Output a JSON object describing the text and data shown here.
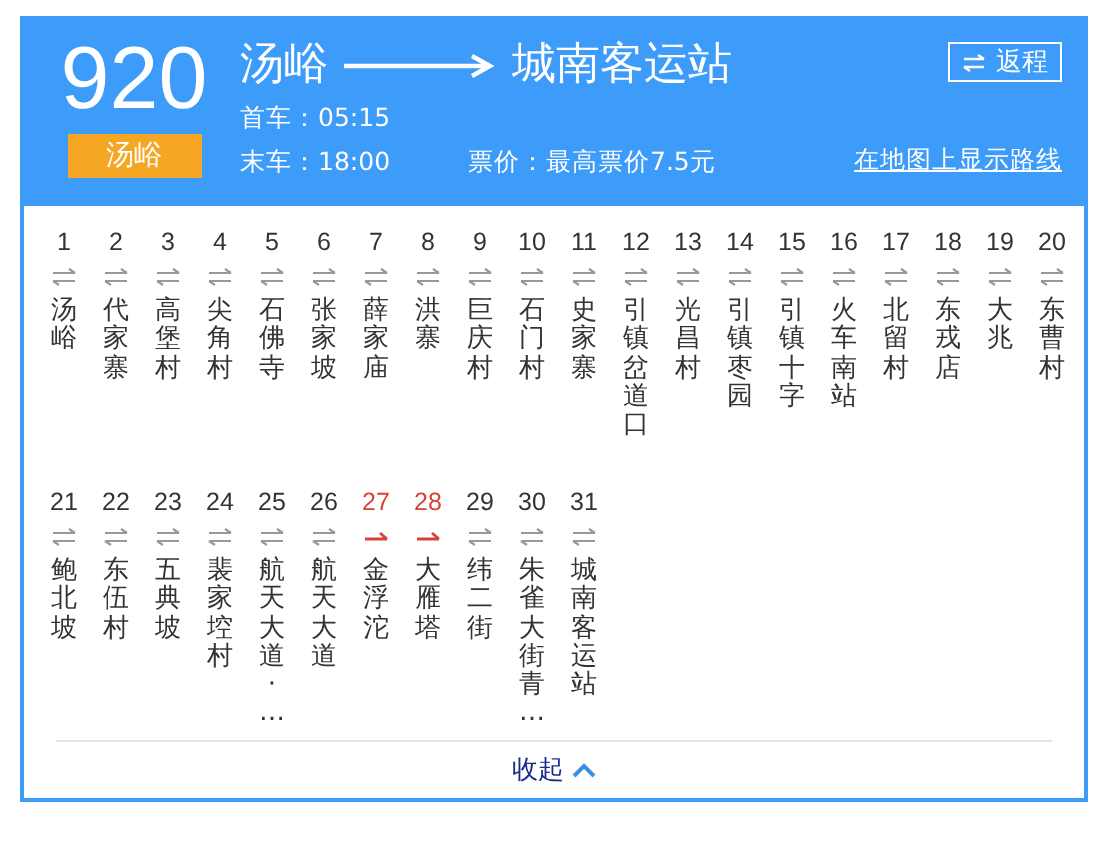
{
  "route": {
    "number": "920",
    "terminal_badge": "汤峪",
    "from": "汤峪",
    "to": "城南客运站",
    "first_bus": "首车：05:15",
    "last_bus": "末车：18:00",
    "fare": "票价：最高票价7.5元",
    "return_button": "返程",
    "map_link": "在地图上显示路线"
  },
  "stops": [
    {
      "number": "1",
      "name": "汤峪",
      "kind": "two_way"
    },
    {
      "number": "2",
      "name": "代家寨",
      "kind": "two_way"
    },
    {
      "number": "3",
      "name": "高堡村",
      "kind": "two_way"
    },
    {
      "number": "4",
      "name": "尖角村",
      "kind": "two_way"
    },
    {
      "number": "5",
      "name": "石佛寺",
      "kind": "two_way"
    },
    {
      "number": "6",
      "name": "张家坡",
      "kind": "two_way"
    },
    {
      "number": "7",
      "name": "薛家庙",
      "kind": "two_way"
    },
    {
      "number": "8",
      "name": "洪寨",
      "kind": "two_way"
    },
    {
      "number": "9",
      "name": "巨庆村",
      "kind": "two_way"
    },
    {
      "number": "10",
      "name": "石门村",
      "kind": "two_way"
    },
    {
      "number": "11",
      "name": "史家寨",
      "kind": "two_way"
    },
    {
      "number": "12",
      "name": "引镇岔道口",
      "kind": "two_way"
    },
    {
      "number": "13",
      "name": "光昌村",
      "kind": "two_way"
    },
    {
      "number": "14",
      "name": "引镇枣园",
      "kind": "two_way"
    },
    {
      "number": "15",
      "name": "引镇十字",
      "kind": "two_way"
    },
    {
      "number": "16",
      "name": "火车南站",
      "kind": "two_way"
    },
    {
      "number": "17",
      "name": "北留村",
      "kind": "two_way"
    },
    {
      "number": "18",
      "name": "东戎店",
      "kind": "two_way"
    },
    {
      "number": "19",
      "name": "大兆",
      "kind": "two_way"
    },
    {
      "number": "20",
      "name": "东曹村",
      "kind": "two_way"
    },
    {
      "number": "21",
      "name": "鲍北坡",
      "kind": "two_way"
    },
    {
      "number": "22",
      "name": "东伍村",
      "kind": "two_way"
    },
    {
      "number": "23",
      "name": "五典坡",
      "kind": "two_way"
    },
    {
      "number": "24",
      "name": "裴家埪村",
      "kind": "two_way"
    },
    {
      "number": "25",
      "name": "航天大道·…",
      "kind": "two_way"
    },
    {
      "number": "26",
      "name": "航天大道",
      "kind": "two_way"
    },
    {
      "number": "27",
      "name": "金浮沱",
      "kind": "one_way"
    },
    {
      "number": "28",
      "name": "大雁塔",
      "kind": "one_way"
    },
    {
      "number": "29",
      "name": "纬二街",
      "kind": "two_way"
    },
    {
      "number": "30",
      "name": "朱雀大街青…",
      "kind": "two_way"
    },
    {
      "number": "31",
      "name": "城南客运站",
      "kind": "two_way"
    }
  ],
  "collapse": "收起"
}
